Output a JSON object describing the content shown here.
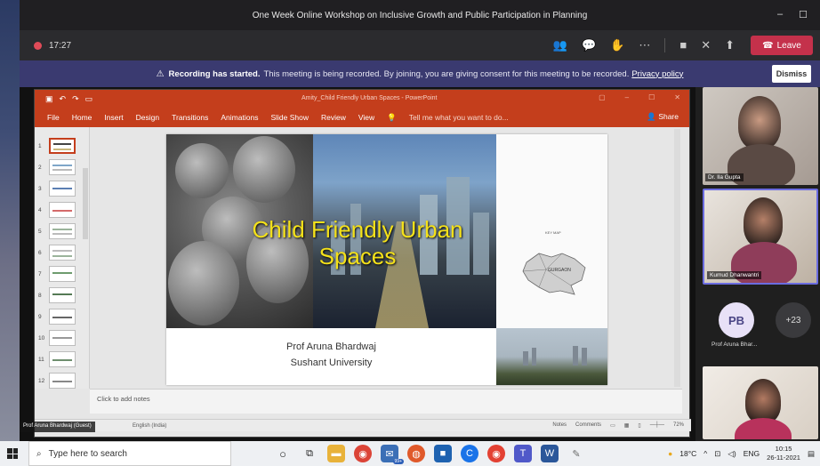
{
  "window": {
    "title": "One Week Online Workshop on Inclusive Growth and Public Participation in Planning",
    "minimize": "–",
    "maximize": "☐"
  },
  "meeting": {
    "timer": "17:27",
    "leave_label": "Leave"
  },
  "banner": {
    "icon": "⚠",
    "bold": "Recording has started.",
    "text": "This meeting is being recorded. By joining, you are giving consent for this meeting to be recorded.",
    "link": "Privacy policy",
    "dismiss": "Dismiss"
  },
  "powerpoint": {
    "doc_title": "Amity_Child Friendly Urban Spaces - PowerPoint",
    "tabs": [
      "File",
      "Home",
      "Insert",
      "Design",
      "Transitions",
      "Animations",
      "Slide Show",
      "Review",
      "View"
    ],
    "tell_me": "Tell me what you want to do...",
    "share": "Share",
    "notes_placeholder": "Click to add notes",
    "status": {
      "lang": "English (India)",
      "notes": "Notes",
      "comments": "Comments",
      "zoom": "72%"
    },
    "thumb_numbers": [
      "1",
      "2",
      "3",
      "4",
      "5",
      "6",
      "7",
      "8",
      "9",
      "10",
      "11",
      "12"
    ]
  },
  "slide": {
    "title_line1": "Child Friendly Urban",
    "title_line2": "Spaces",
    "author": "Prof Aruna Bhardwaj",
    "affiliation": "Sushant University",
    "map_label": "KEY MAP",
    "map_city": "GURGAON"
  },
  "presenter_tag": "Prof Aruna Bhardwaj (Guest)",
  "participants": {
    "p1": "Dr. Ila Gupta",
    "p2": "Kumud Dhanwantri",
    "avatar_initials": "PB",
    "avatar_name": "Prof Aruna Bhar...",
    "more_count": "+23"
  },
  "taskbar": {
    "search_placeholder": "Type here to search",
    "badge": "99+",
    "weather": "18°C",
    "lang": "ENG",
    "time": "10:15",
    "date": "26-11-2021"
  },
  "colors": {
    "ppt_accent": "#c43e1c",
    "teams_leave": "#c4314b",
    "banner_bg": "#3a3a70",
    "slide_title": "#f4e11a"
  }
}
